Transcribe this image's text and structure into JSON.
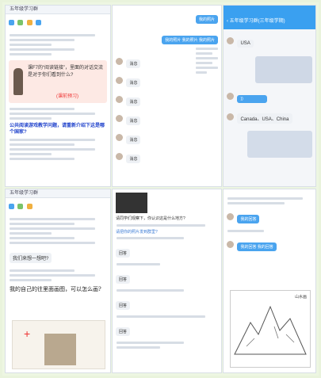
{
  "collage": {
    "top_left": {
      "title": "五年级学习群",
      "card_text": "课F7的“阅读链接”，里面的对话交流是对于你们看到什么?",
      "card_red": "(课前预习)",
      "question_blue": "公共阅读游戏教学问题，请重新介绍下这是哪个国家?",
      "card_color": "#fde9e4"
    },
    "top_middle": {
      "top_button": "我的照片",
      "blue_bubble": "我的照片 我的照片 我的照片",
      "list_labels": [
        "消息",
        "消息",
        "消息",
        "消息",
        "消息",
        "消息"
      ]
    },
    "top_right": {
      "header_title": "五年级学习群(三年级学期)",
      "usa_label": "USA",
      "countries_text": "Canada、USA、China",
      "header_color": "#3aa0f0"
    },
    "bottom_left": {
      "title": "五年级学习群",
      "gray_bubble": "我们来想一想吧?",
      "handwriting": "我的自己的往里面画图，可以怎么画?"
    },
    "bottom_middle": {
      "question": "请同学们观察下，你认识这是什么地方?",
      "link_text": "请把你的照片发到群里?",
      "answers": [
        "回答",
        "回答",
        "回答",
        "回答"
      ]
    },
    "bottom_right": {
      "blue_bubble_1": "我的回答",
      "blue_bubble_2": "我的回答 我的回答",
      "sketch_label": "山水画"
    }
  }
}
